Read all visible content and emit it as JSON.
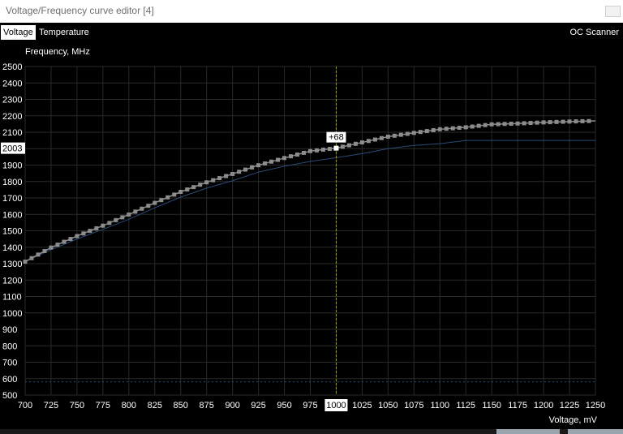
{
  "window": {
    "title": "Voltage/Frequency curve editor [4]"
  },
  "tabs": [
    {
      "label": "Voltage",
      "active": true
    },
    {
      "label": "Temperature",
      "active": false
    }
  ],
  "toolbar": {
    "oc_scanner_label": "OC Scanner"
  },
  "colors": {
    "background": "#000000",
    "grid": "#2a2a2a",
    "curve_points": "#8c8c8c",
    "base_curve": "#2c4a78",
    "cursor_line": "#9a9a40"
  },
  "chart_data": {
    "type": "line",
    "xlabel": "Voltage, mV",
    "ylabel": "Frequency, MHz",
    "xlim": [
      700,
      1250
    ],
    "ylim": [
      500,
      2500
    ],
    "grid": true,
    "x_ticks": [
      700,
      725,
      750,
      775,
      800,
      825,
      850,
      875,
      900,
      925,
      950,
      975,
      1000,
      1025,
      1050,
      1075,
      1100,
      1125,
      1150,
      1175,
      1200,
      1225,
      1250
    ],
    "y_ticks": [
      500,
      600,
      700,
      800,
      900,
      1000,
      1100,
      1200,
      1300,
      1400,
      1500,
      1600,
      1700,
      1800,
      1900,
      2000,
      2100,
      2200,
      2300,
      2400,
      2500
    ],
    "series": [
      {
        "role": "adjusted curve",
        "style": "square-markers",
        "x": [
          700,
          725,
          750,
          775,
          800,
          825,
          850,
          875,
          900,
          925,
          950,
          975,
          1000,
          1025,
          1050,
          1075,
          1100,
          1125,
          1150,
          1175,
          1200,
          1225,
          1250
        ],
        "y": [
          1312,
          1398,
          1468,
          1531,
          1599,
          1670,
          1737,
          1795,
          1846,
          1899,
          1943,
          1985,
          2003,
          2038,
          2073,
          2096,
          2118,
          2130,
          2148,
          2153,
          2160,
          2165,
          2169
        ]
      },
      {
        "role": "base curve",
        "style": "thin-line",
        "x": [
          700,
          725,
          750,
          775,
          800,
          825,
          850,
          875,
          900,
          925,
          950,
          975,
          1000,
          1025,
          1050,
          1075,
          1100,
          1125,
          1150,
          1175,
          1200,
          1225,
          1250
        ],
        "y": [
          1312,
          1385,
          1450,
          1509,
          1570,
          1640,
          1705,
          1760,
          1805,
          1857,
          1893,
          1922,
          1945,
          1970,
          2000,
          2020,
          2030,
          2050,
          2050,
          2050,
          2050,
          2050,
          2050
        ]
      },
      {
        "role": "lower reference",
        "style": "dashed-line",
        "x": [
          700,
          1250
        ],
        "y": [
          580,
          580
        ]
      }
    ],
    "cursor": {
      "x": 1000,
      "y": 2003,
      "offset_label": "+68"
    }
  }
}
